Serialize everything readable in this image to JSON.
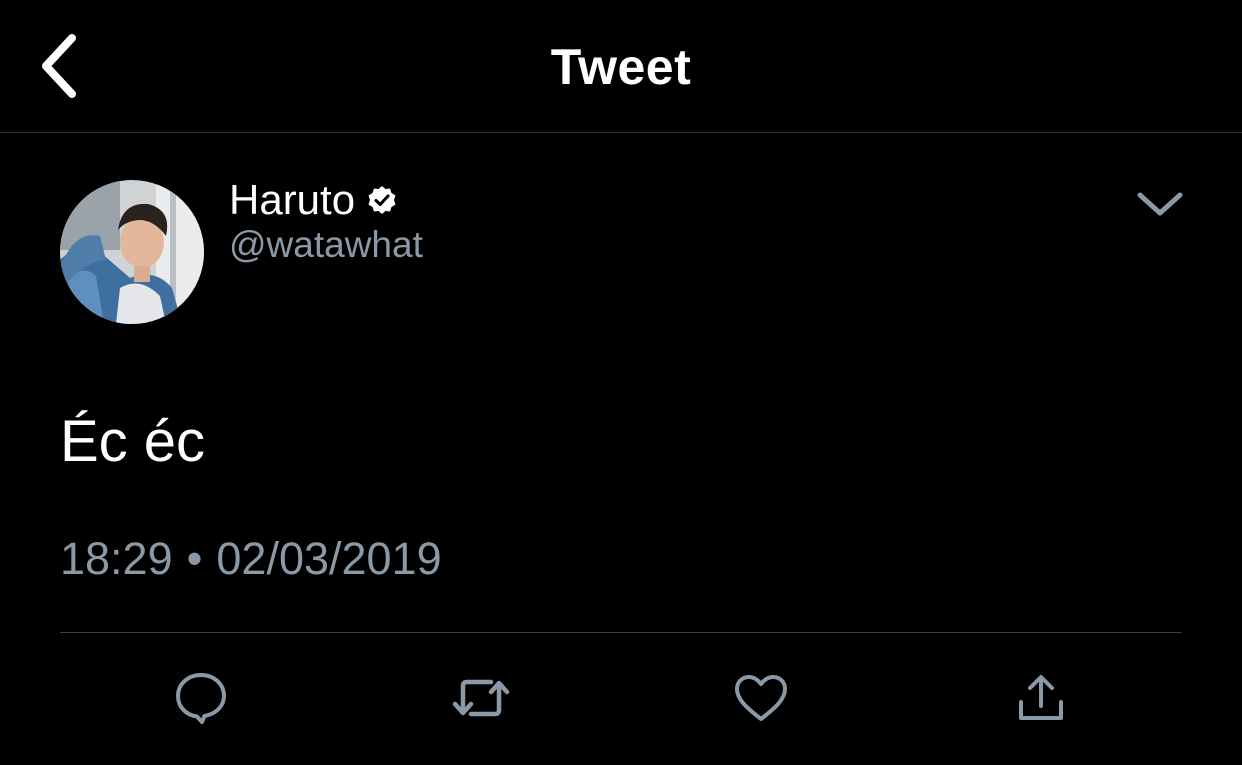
{
  "header": {
    "title": "Tweet",
    "back_icon": "chevron-left-icon"
  },
  "tweet": {
    "author": {
      "name": "Haruto",
      "handle": "@watawhat",
      "verified": true,
      "verified_icon": "verified-badge-icon"
    },
    "menu_icon": "chevron-down-icon",
    "text": "Éc éc",
    "time": "18:29",
    "separator": "•",
    "date": "02/03/2019"
  },
  "actions": [
    {
      "name": "reply",
      "icon": "comment-bubble-icon"
    },
    {
      "name": "retweet",
      "icon": "retweet-icon"
    },
    {
      "name": "like",
      "icon": "heart-icon"
    },
    {
      "name": "share",
      "icon": "share-upload-icon"
    }
  ],
  "colors": {
    "background": "#000000",
    "primary_text": "#ffffff",
    "secondary_text": "#8b98a5",
    "divider": "#3a3e42"
  }
}
